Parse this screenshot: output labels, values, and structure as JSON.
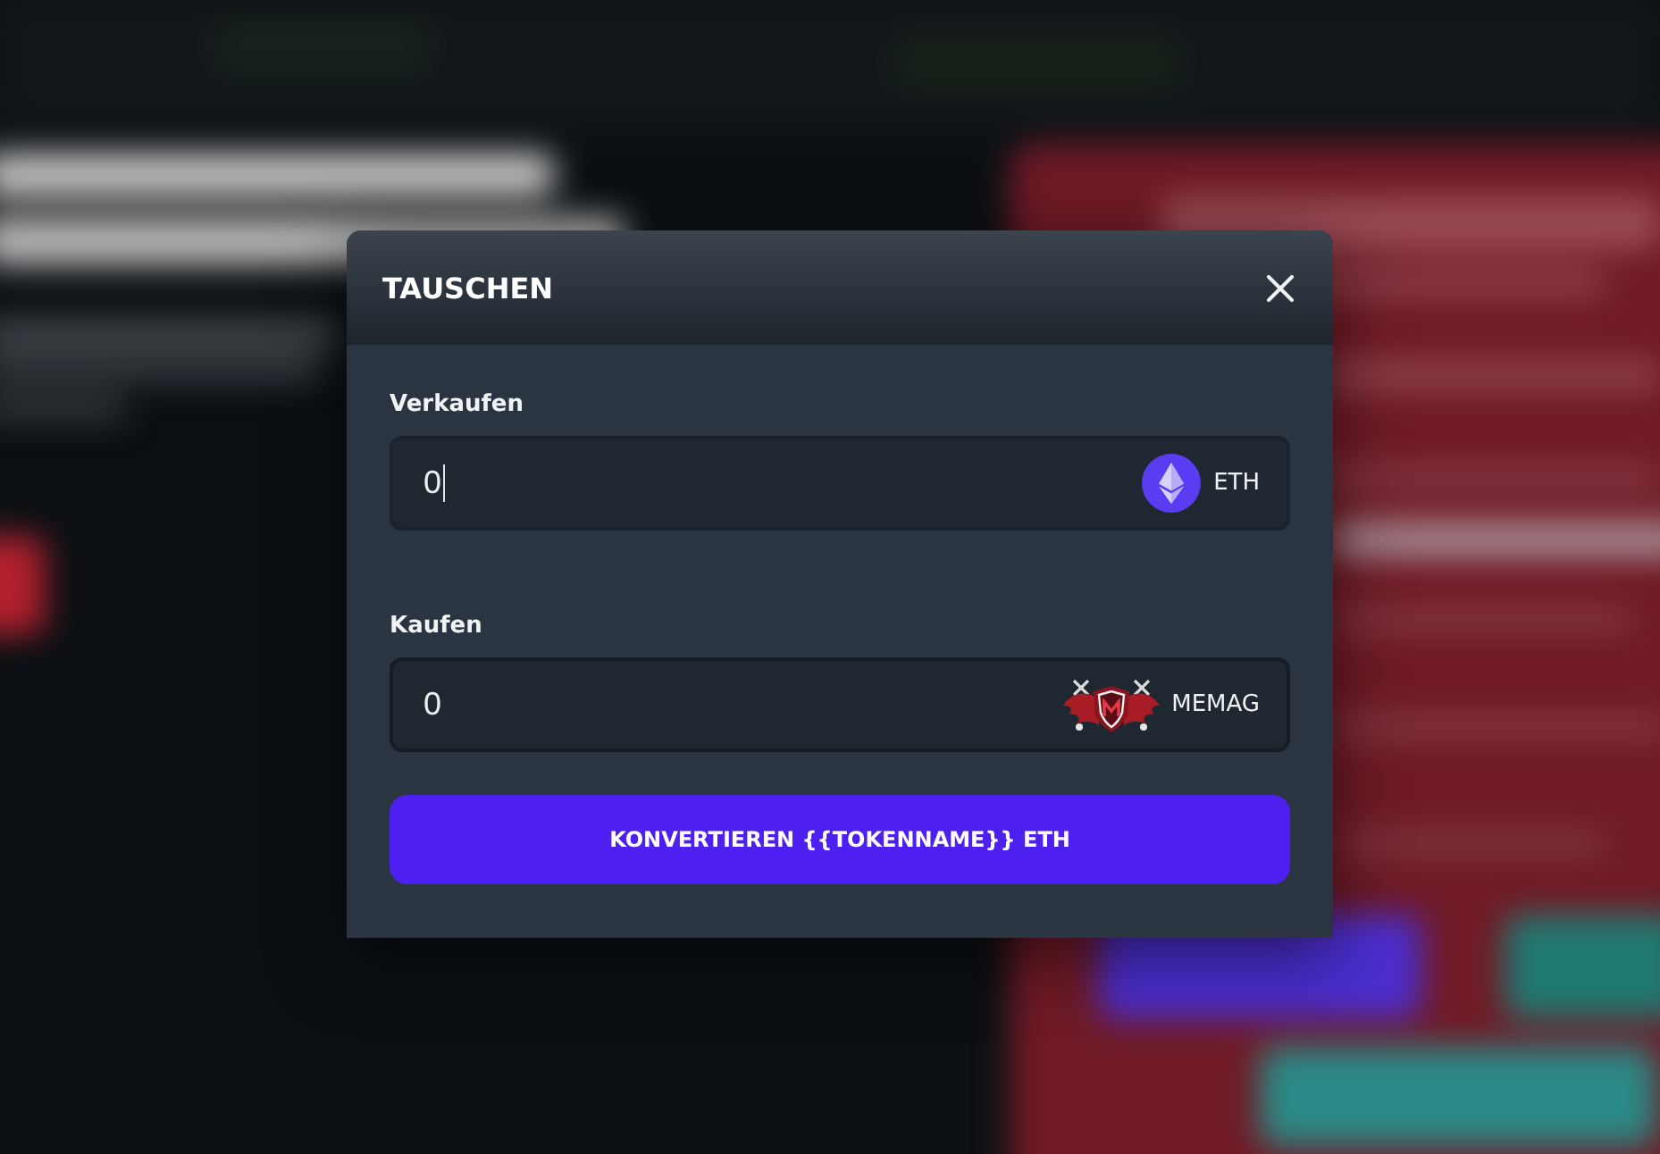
{
  "modal": {
    "title": "TAUSCHEN",
    "fields": [
      {
        "label": "Verkaufen",
        "value": "0",
        "focused": true,
        "token": {
          "kind": "eth",
          "symbol": "ETH"
        }
      },
      {
        "label": "Kaufen",
        "value": "0",
        "focused": false,
        "token": {
          "kind": "memag",
          "symbol": "MEMAG"
        }
      }
    ],
    "submit_button": "KONVERTIEREN {{TOKENNAME}} ETH"
  }
}
